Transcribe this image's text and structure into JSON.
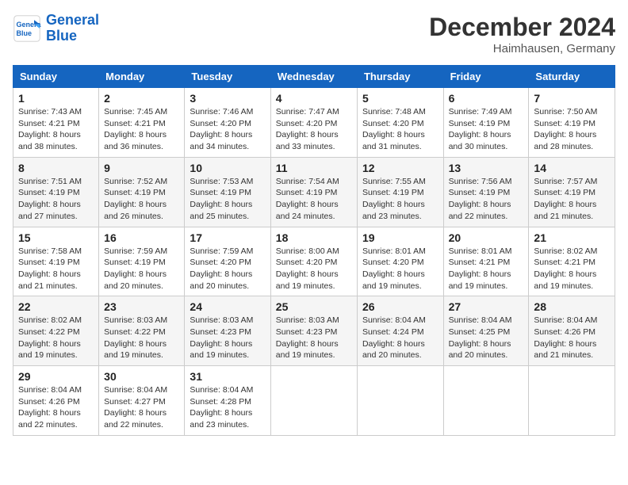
{
  "header": {
    "logo_line1": "General",
    "logo_line2": "Blue",
    "month": "December 2024",
    "location": "Haimhausen, Germany"
  },
  "days_of_week": [
    "Sunday",
    "Monday",
    "Tuesday",
    "Wednesday",
    "Thursday",
    "Friday",
    "Saturday"
  ],
  "weeks": [
    [
      {
        "day": "1",
        "info": "Sunrise: 7:43 AM\nSunset: 4:21 PM\nDaylight: 8 hours and 38 minutes."
      },
      {
        "day": "2",
        "info": "Sunrise: 7:45 AM\nSunset: 4:21 PM\nDaylight: 8 hours and 36 minutes."
      },
      {
        "day": "3",
        "info": "Sunrise: 7:46 AM\nSunset: 4:20 PM\nDaylight: 8 hours and 34 minutes."
      },
      {
        "day": "4",
        "info": "Sunrise: 7:47 AM\nSunset: 4:20 PM\nDaylight: 8 hours and 33 minutes."
      },
      {
        "day": "5",
        "info": "Sunrise: 7:48 AM\nSunset: 4:20 PM\nDaylight: 8 hours and 31 minutes."
      },
      {
        "day": "6",
        "info": "Sunrise: 7:49 AM\nSunset: 4:19 PM\nDaylight: 8 hours and 30 minutes."
      },
      {
        "day": "7",
        "info": "Sunrise: 7:50 AM\nSunset: 4:19 PM\nDaylight: 8 hours and 28 minutes."
      }
    ],
    [
      {
        "day": "8",
        "info": "Sunrise: 7:51 AM\nSunset: 4:19 PM\nDaylight: 8 hours and 27 minutes."
      },
      {
        "day": "9",
        "info": "Sunrise: 7:52 AM\nSunset: 4:19 PM\nDaylight: 8 hours and 26 minutes."
      },
      {
        "day": "10",
        "info": "Sunrise: 7:53 AM\nSunset: 4:19 PM\nDaylight: 8 hours and 25 minutes."
      },
      {
        "day": "11",
        "info": "Sunrise: 7:54 AM\nSunset: 4:19 PM\nDaylight: 8 hours and 24 minutes."
      },
      {
        "day": "12",
        "info": "Sunrise: 7:55 AM\nSunset: 4:19 PM\nDaylight: 8 hours and 23 minutes."
      },
      {
        "day": "13",
        "info": "Sunrise: 7:56 AM\nSunset: 4:19 PM\nDaylight: 8 hours and 22 minutes."
      },
      {
        "day": "14",
        "info": "Sunrise: 7:57 AM\nSunset: 4:19 PM\nDaylight: 8 hours and 21 minutes."
      }
    ],
    [
      {
        "day": "15",
        "info": "Sunrise: 7:58 AM\nSunset: 4:19 PM\nDaylight: 8 hours and 21 minutes."
      },
      {
        "day": "16",
        "info": "Sunrise: 7:59 AM\nSunset: 4:19 PM\nDaylight: 8 hours and 20 minutes."
      },
      {
        "day": "17",
        "info": "Sunrise: 7:59 AM\nSunset: 4:20 PM\nDaylight: 8 hours and 20 minutes."
      },
      {
        "day": "18",
        "info": "Sunrise: 8:00 AM\nSunset: 4:20 PM\nDaylight: 8 hours and 19 minutes."
      },
      {
        "day": "19",
        "info": "Sunrise: 8:01 AM\nSunset: 4:20 PM\nDaylight: 8 hours and 19 minutes."
      },
      {
        "day": "20",
        "info": "Sunrise: 8:01 AM\nSunset: 4:21 PM\nDaylight: 8 hours and 19 minutes."
      },
      {
        "day": "21",
        "info": "Sunrise: 8:02 AM\nSunset: 4:21 PM\nDaylight: 8 hours and 19 minutes."
      }
    ],
    [
      {
        "day": "22",
        "info": "Sunrise: 8:02 AM\nSunset: 4:22 PM\nDaylight: 8 hours and 19 minutes."
      },
      {
        "day": "23",
        "info": "Sunrise: 8:03 AM\nSunset: 4:22 PM\nDaylight: 8 hours and 19 minutes."
      },
      {
        "day": "24",
        "info": "Sunrise: 8:03 AM\nSunset: 4:23 PM\nDaylight: 8 hours and 19 minutes."
      },
      {
        "day": "25",
        "info": "Sunrise: 8:03 AM\nSunset: 4:23 PM\nDaylight: 8 hours and 19 minutes."
      },
      {
        "day": "26",
        "info": "Sunrise: 8:04 AM\nSunset: 4:24 PM\nDaylight: 8 hours and 20 minutes."
      },
      {
        "day": "27",
        "info": "Sunrise: 8:04 AM\nSunset: 4:25 PM\nDaylight: 8 hours and 20 minutes."
      },
      {
        "day": "28",
        "info": "Sunrise: 8:04 AM\nSunset: 4:26 PM\nDaylight: 8 hours and 21 minutes."
      }
    ],
    [
      {
        "day": "29",
        "info": "Sunrise: 8:04 AM\nSunset: 4:26 PM\nDaylight: 8 hours and 22 minutes."
      },
      {
        "day": "30",
        "info": "Sunrise: 8:04 AM\nSunset: 4:27 PM\nDaylight: 8 hours and 22 minutes."
      },
      {
        "day": "31",
        "info": "Sunrise: 8:04 AM\nSunset: 4:28 PM\nDaylight: 8 hours and 23 minutes."
      },
      null,
      null,
      null,
      null
    ]
  ]
}
